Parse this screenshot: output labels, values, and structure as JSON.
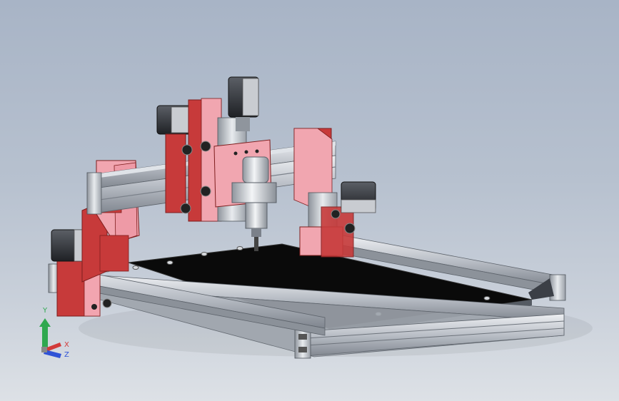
{
  "viewport": {
    "background_top": "#a8b4c6",
    "background_bottom": "#dde1e6"
  },
  "model": {
    "name": "cnc-router-assembly",
    "colors": {
      "aluminum": "#c9cdd3",
      "aluminum_dark": "#8e949c",
      "red_plate": "#c73a3a",
      "pink_plate": "#f1a6b0",
      "bed": "#0c0c0c",
      "motor": "#3a3d42",
      "spindle": "#d9dde2"
    }
  },
  "triad": {
    "y_label": "Y",
    "x_label": "X",
    "z_label": "Z",
    "y_color": "#2fa84f",
    "x_color": "#d23a3a",
    "z_color": "#2f52d6"
  }
}
